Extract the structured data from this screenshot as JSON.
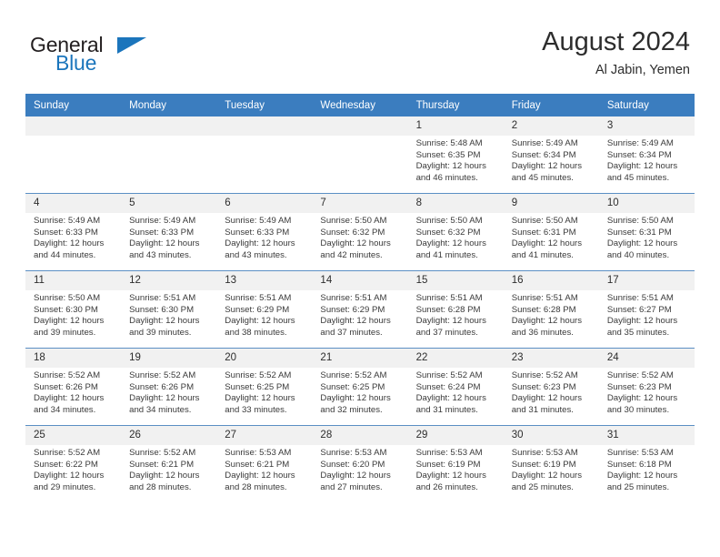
{
  "brand": {
    "line1": "General",
    "line2": "Blue",
    "triangle_icon": "triangle-icon",
    "color_dark": "#231f20",
    "color_blue": "#1b75bc"
  },
  "header": {
    "title": "August 2024",
    "subtitle": "Al Jabin, Yemen"
  },
  "theme": {
    "header_bg": "#3b7dbf",
    "header_text": "#ffffff",
    "daynum_bg": "#f1f1f1",
    "row_border": "#5b8fc4",
    "cell_bg": "#ffffff",
    "body_text": "#3a3a3a"
  },
  "labels": {
    "sunrise": "Sunrise:",
    "sunset": "Sunset:",
    "daylight": "Daylight:"
  },
  "weekdays": [
    "Sunday",
    "Monday",
    "Tuesday",
    "Wednesday",
    "Thursday",
    "Friday",
    "Saturday"
  ],
  "weeks": [
    [
      {
        "day": "",
        "empty": true,
        "sunrise": "",
        "sunset": "",
        "daylight1": "",
        "daylight2": ""
      },
      {
        "day": "",
        "empty": true,
        "sunrise": "",
        "sunset": "",
        "daylight1": "",
        "daylight2": ""
      },
      {
        "day": "",
        "empty": true,
        "sunrise": "",
        "sunset": "",
        "daylight1": "",
        "daylight2": ""
      },
      {
        "day": "",
        "empty": true,
        "sunrise": "",
        "sunset": "",
        "daylight1": "",
        "daylight2": ""
      },
      {
        "day": "1",
        "empty": false,
        "sunrise": "Sunrise: 5:48 AM",
        "sunset": "Sunset: 6:35 PM",
        "daylight1": "Daylight: 12 hours",
        "daylight2": "and 46 minutes."
      },
      {
        "day": "2",
        "empty": false,
        "sunrise": "Sunrise: 5:49 AM",
        "sunset": "Sunset: 6:34 PM",
        "daylight1": "Daylight: 12 hours",
        "daylight2": "and 45 minutes."
      },
      {
        "day": "3",
        "empty": false,
        "sunrise": "Sunrise: 5:49 AM",
        "sunset": "Sunset: 6:34 PM",
        "daylight1": "Daylight: 12 hours",
        "daylight2": "and 45 minutes."
      }
    ],
    [
      {
        "day": "4",
        "empty": false,
        "sunrise": "Sunrise: 5:49 AM",
        "sunset": "Sunset: 6:33 PM",
        "daylight1": "Daylight: 12 hours",
        "daylight2": "and 44 minutes."
      },
      {
        "day": "5",
        "empty": false,
        "sunrise": "Sunrise: 5:49 AM",
        "sunset": "Sunset: 6:33 PM",
        "daylight1": "Daylight: 12 hours",
        "daylight2": "and 43 minutes."
      },
      {
        "day": "6",
        "empty": false,
        "sunrise": "Sunrise: 5:49 AM",
        "sunset": "Sunset: 6:33 PM",
        "daylight1": "Daylight: 12 hours",
        "daylight2": "and 43 minutes."
      },
      {
        "day": "7",
        "empty": false,
        "sunrise": "Sunrise: 5:50 AM",
        "sunset": "Sunset: 6:32 PM",
        "daylight1": "Daylight: 12 hours",
        "daylight2": "and 42 minutes."
      },
      {
        "day": "8",
        "empty": false,
        "sunrise": "Sunrise: 5:50 AM",
        "sunset": "Sunset: 6:32 PM",
        "daylight1": "Daylight: 12 hours",
        "daylight2": "and 41 minutes."
      },
      {
        "day": "9",
        "empty": false,
        "sunrise": "Sunrise: 5:50 AM",
        "sunset": "Sunset: 6:31 PM",
        "daylight1": "Daylight: 12 hours",
        "daylight2": "and 41 minutes."
      },
      {
        "day": "10",
        "empty": false,
        "sunrise": "Sunrise: 5:50 AM",
        "sunset": "Sunset: 6:31 PM",
        "daylight1": "Daylight: 12 hours",
        "daylight2": "and 40 minutes."
      }
    ],
    [
      {
        "day": "11",
        "empty": false,
        "sunrise": "Sunrise: 5:50 AM",
        "sunset": "Sunset: 6:30 PM",
        "daylight1": "Daylight: 12 hours",
        "daylight2": "and 39 minutes."
      },
      {
        "day": "12",
        "empty": false,
        "sunrise": "Sunrise: 5:51 AM",
        "sunset": "Sunset: 6:30 PM",
        "daylight1": "Daylight: 12 hours",
        "daylight2": "and 39 minutes."
      },
      {
        "day": "13",
        "empty": false,
        "sunrise": "Sunrise: 5:51 AM",
        "sunset": "Sunset: 6:29 PM",
        "daylight1": "Daylight: 12 hours",
        "daylight2": "and 38 minutes."
      },
      {
        "day": "14",
        "empty": false,
        "sunrise": "Sunrise: 5:51 AM",
        "sunset": "Sunset: 6:29 PM",
        "daylight1": "Daylight: 12 hours",
        "daylight2": "and 37 minutes."
      },
      {
        "day": "15",
        "empty": false,
        "sunrise": "Sunrise: 5:51 AM",
        "sunset": "Sunset: 6:28 PM",
        "daylight1": "Daylight: 12 hours",
        "daylight2": "and 37 minutes."
      },
      {
        "day": "16",
        "empty": false,
        "sunrise": "Sunrise: 5:51 AM",
        "sunset": "Sunset: 6:28 PM",
        "daylight1": "Daylight: 12 hours",
        "daylight2": "and 36 minutes."
      },
      {
        "day": "17",
        "empty": false,
        "sunrise": "Sunrise: 5:51 AM",
        "sunset": "Sunset: 6:27 PM",
        "daylight1": "Daylight: 12 hours",
        "daylight2": "and 35 minutes."
      }
    ],
    [
      {
        "day": "18",
        "empty": false,
        "sunrise": "Sunrise: 5:52 AM",
        "sunset": "Sunset: 6:26 PM",
        "daylight1": "Daylight: 12 hours",
        "daylight2": "and 34 minutes."
      },
      {
        "day": "19",
        "empty": false,
        "sunrise": "Sunrise: 5:52 AM",
        "sunset": "Sunset: 6:26 PM",
        "daylight1": "Daylight: 12 hours",
        "daylight2": "and 34 minutes."
      },
      {
        "day": "20",
        "empty": false,
        "sunrise": "Sunrise: 5:52 AM",
        "sunset": "Sunset: 6:25 PM",
        "daylight1": "Daylight: 12 hours",
        "daylight2": "and 33 minutes."
      },
      {
        "day": "21",
        "empty": false,
        "sunrise": "Sunrise: 5:52 AM",
        "sunset": "Sunset: 6:25 PM",
        "daylight1": "Daylight: 12 hours",
        "daylight2": "and 32 minutes."
      },
      {
        "day": "22",
        "empty": false,
        "sunrise": "Sunrise: 5:52 AM",
        "sunset": "Sunset: 6:24 PM",
        "daylight1": "Daylight: 12 hours",
        "daylight2": "and 31 minutes."
      },
      {
        "day": "23",
        "empty": false,
        "sunrise": "Sunrise: 5:52 AM",
        "sunset": "Sunset: 6:23 PM",
        "daylight1": "Daylight: 12 hours",
        "daylight2": "and 31 minutes."
      },
      {
        "day": "24",
        "empty": false,
        "sunrise": "Sunrise: 5:52 AM",
        "sunset": "Sunset: 6:23 PM",
        "daylight1": "Daylight: 12 hours",
        "daylight2": "and 30 minutes."
      }
    ],
    [
      {
        "day": "25",
        "empty": false,
        "sunrise": "Sunrise: 5:52 AM",
        "sunset": "Sunset: 6:22 PM",
        "daylight1": "Daylight: 12 hours",
        "daylight2": "and 29 minutes."
      },
      {
        "day": "26",
        "empty": false,
        "sunrise": "Sunrise: 5:52 AM",
        "sunset": "Sunset: 6:21 PM",
        "daylight1": "Daylight: 12 hours",
        "daylight2": "and 28 minutes."
      },
      {
        "day": "27",
        "empty": false,
        "sunrise": "Sunrise: 5:53 AM",
        "sunset": "Sunset: 6:21 PM",
        "daylight1": "Daylight: 12 hours",
        "daylight2": "and 28 minutes."
      },
      {
        "day": "28",
        "empty": false,
        "sunrise": "Sunrise: 5:53 AM",
        "sunset": "Sunset: 6:20 PM",
        "daylight1": "Daylight: 12 hours",
        "daylight2": "and 27 minutes."
      },
      {
        "day": "29",
        "empty": false,
        "sunrise": "Sunrise: 5:53 AM",
        "sunset": "Sunset: 6:19 PM",
        "daylight1": "Daylight: 12 hours",
        "daylight2": "and 26 minutes."
      },
      {
        "day": "30",
        "empty": false,
        "sunrise": "Sunrise: 5:53 AM",
        "sunset": "Sunset: 6:19 PM",
        "daylight1": "Daylight: 12 hours",
        "daylight2": "and 25 minutes."
      },
      {
        "day": "31",
        "empty": false,
        "sunrise": "Sunrise: 5:53 AM",
        "sunset": "Sunset: 6:18 PM",
        "daylight1": "Daylight: 12 hours",
        "daylight2": "and 25 minutes."
      }
    ]
  ]
}
